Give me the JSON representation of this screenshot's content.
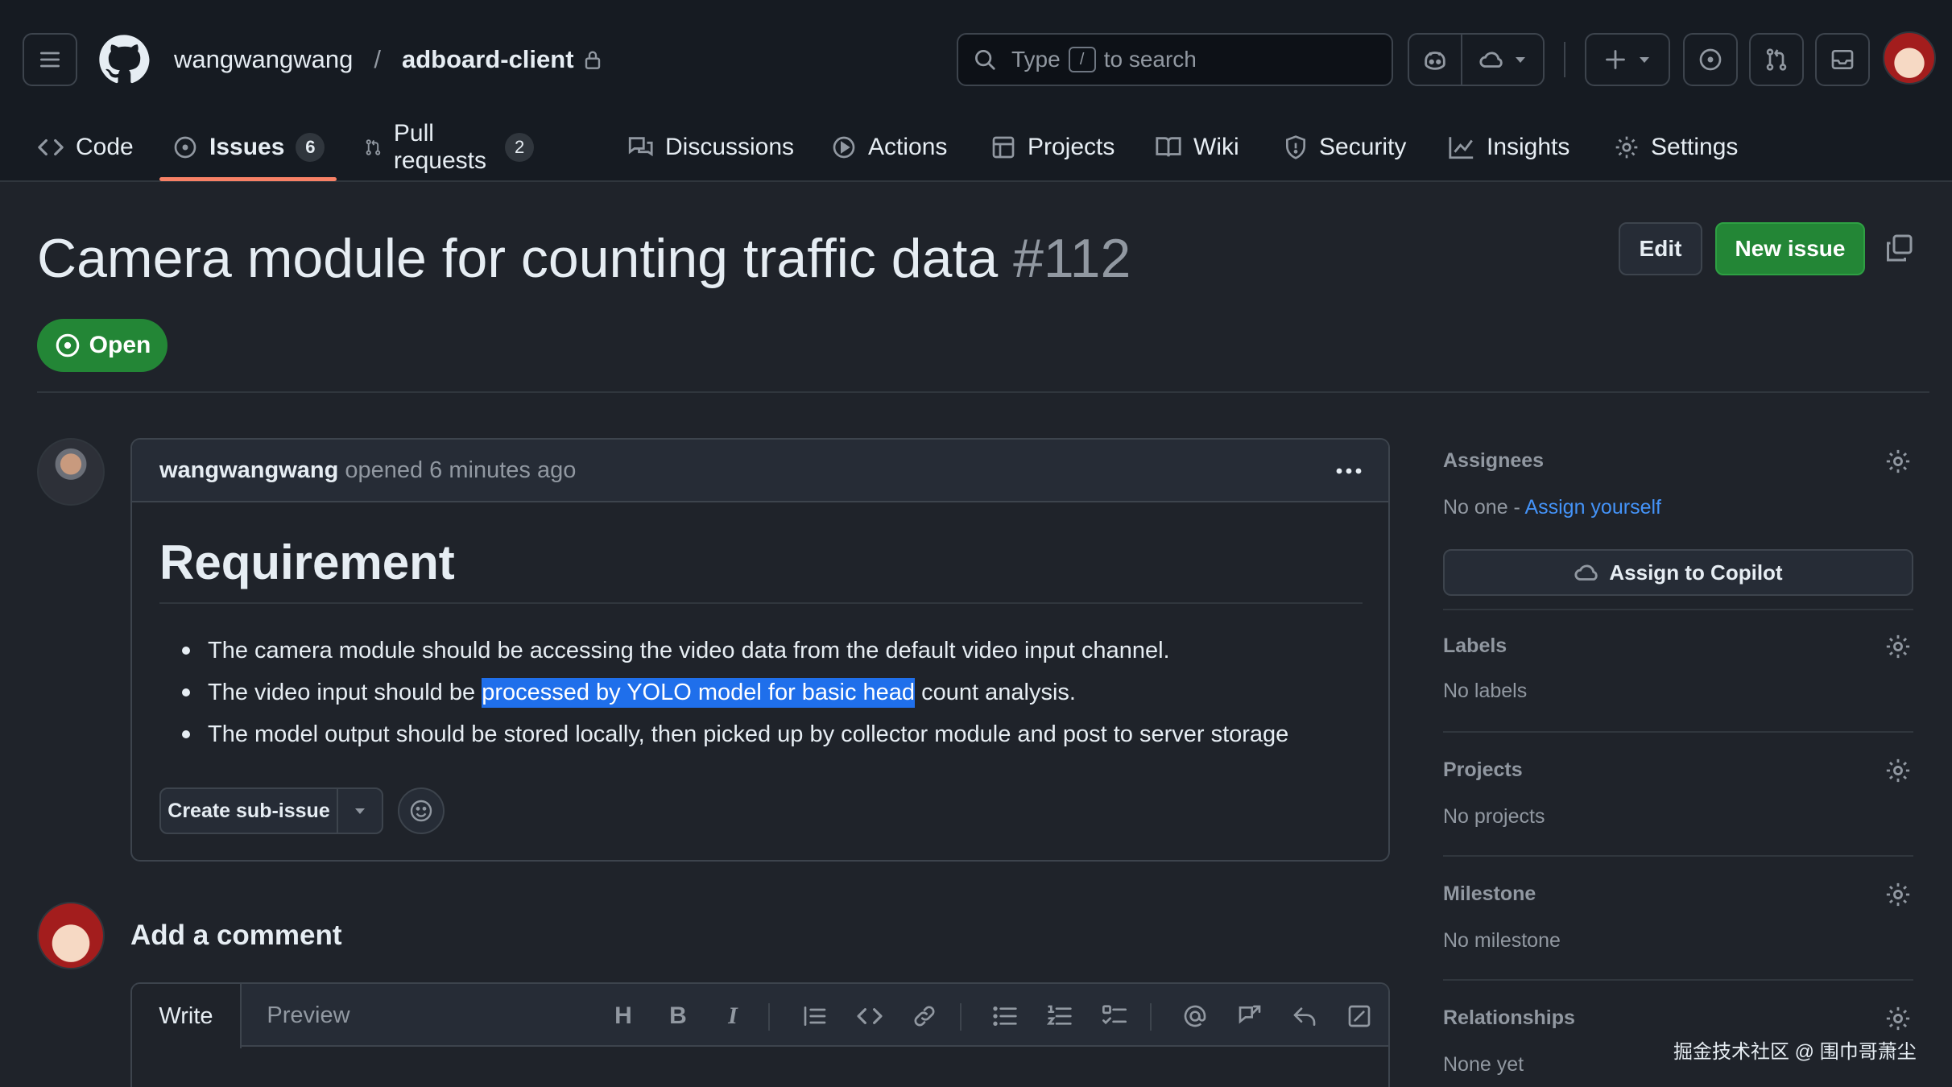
{
  "header": {
    "owner": "wangwangwang",
    "separator": "/",
    "repo": "adboard-client",
    "search": {
      "prefix": "Type",
      "key": "/",
      "suffix": "to search"
    }
  },
  "tabs": [
    {
      "label": "Code",
      "icon": "code-icon"
    },
    {
      "label": "Issues",
      "icon": "issue-opened-icon",
      "count": "6"
    },
    {
      "label": "Pull requests",
      "icon": "git-pull-request-icon",
      "count": "2"
    },
    {
      "label": "Discussions",
      "icon": "comment-discussion-icon"
    },
    {
      "label": "Actions",
      "icon": "play-icon"
    },
    {
      "label": "Projects",
      "icon": "table-icon"
    },
    {
      "label": "Wiki",
      "icon": "book-icon"
    },
    {
      "label": "Security",
      "icon": "shield-icon"
    },
    {
      "label": "Insights",
      "icon": "graph-icon"
    },
    {
      "label": "Settings",
      "icon": "gear-icon"
    }
  ],
  "issue": {
    "title": "Camera module for counting traffic data",
    "number": "#112",
    "state": "Open",
    "edit_label": "Edit",
    "new_issue_label": "New issue",
    "author": "wangwangwang",
    "opened_text": "opened 6 minutes ago",
    "body": {
      "heading": "Requirement",
      "items": [
        {
          "text": "The camera module should be accessing the video data from the default video input channel."
        },
        {
          "before": "The video input should be ",
          "highlight": "processed by YOLO model for basic head",
          "after": " count analysis."
        },
        {
          "text": "The model output should be stored locally, then picked up by collector module and post to server storage"
        }
      ]
    },
    "create_subissue_label": "Create sub-issue"
  },
  "comment": {
    "heading": "Add a comment",
    "tab_write": "Write",
    "tab_preview": "Preview",
    "toolbar_heading": "H",
    "toolbar_bold": "B",
    "toolbar_italic": "I"
  },
  "sidebar": {
    "assignees": {
      "label": "Assignees",
      "value": "No one - ",
      "link": "Assign yourself"
    },
    "copilot_label": "Assign to Copilot",
    "labels": {
      "label": "Labels",
      "value": "No labels"
    },
    "projects": {
      "label": "Projects",
      "value": "No projects"
    },
    "milestone": {
      "label": "Milestone",
      "value": "No milestone"
    },
    "relationships": {
      "label": "Relationships",
      "value": "None yet"
    }
  },
  "watermark": "掘金技术社区 @ 围巾哥萧尘",
  "colors": {
    "background": "#1f232a",
    "header": "#161b22",
    "accent_green": "#238636",
    "link_blue": "#4493f8",
    "tab_underline": "#f78166",
    "selection": "#1f6feb"
  }
}
